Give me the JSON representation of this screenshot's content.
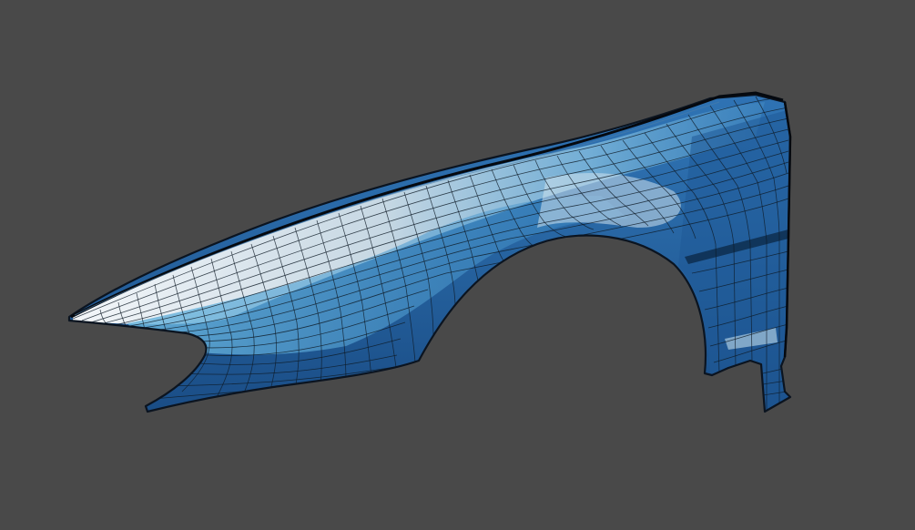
{
  "viewport": {
    "background_color": "#494949"
  },
  "model": {
    "object": "car-front-fender",
    "display_mode": "wireframe-on-shaded",
    "surface_colors": {
      "deep_blue": "#1a4d86",
      "mid_blue": "#2f73b4",
      "light_blue": "#6ab5dd",
      "highlight": "#d8e4ea",
      "edge_outline": "#0b1420",
      "wire": "#0e1a26"
    }
  }
}
